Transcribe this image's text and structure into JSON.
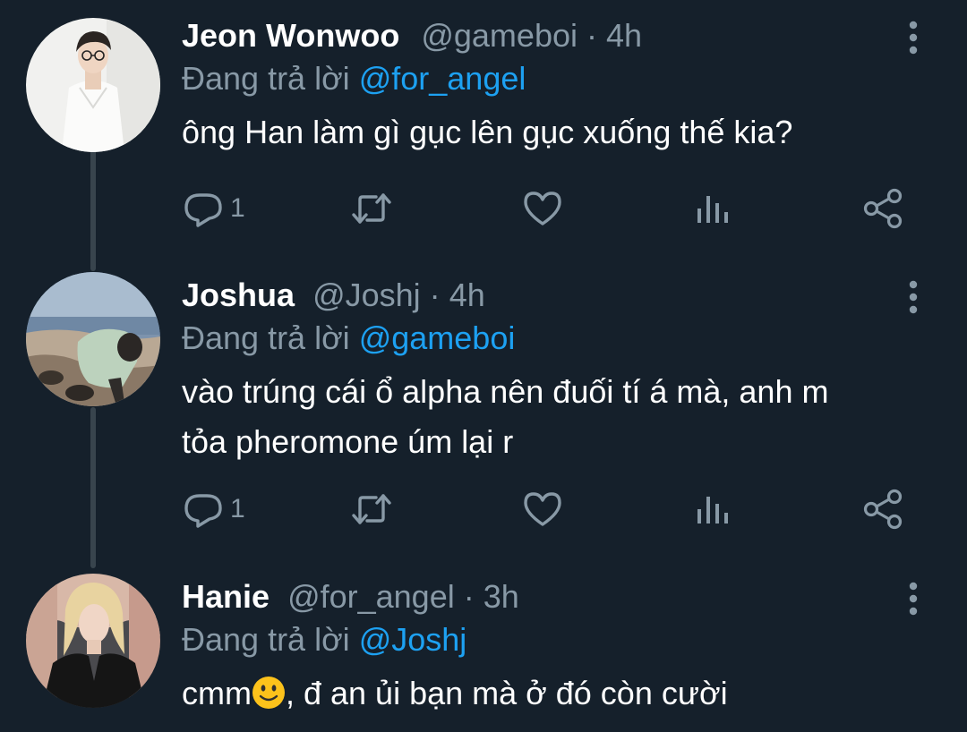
{
  "colors": {
    "background": "#15202b",
    "text_primary": "#ffffff",
    "text_secondary": "#8899a6",
    "accent": "#1da1f2",
    "thread_line": "#38444d"
  },
  "tweets": [
    {
      "name": "Jeon Wonwoo",
      "handle": "@gameboi",
      "separator": "·",
      "time": "4h",
      "reply_prefix": "Đang trả lời",
      "reply_to": "@for_angel",
      "text": "ông Han làm gì gục lên gục xuống thế kia?",
      "reply_count": "1"
    },
    {
      "name": "Joshua",
      "handle": "@Joshj",
      "separator": "·",
      "time": "4h",
      "reply_prefix": "Đang trả lời",
      "reply_to": "@gameboi",
      "text_line1": "vào trúng cái ổ alpha nên đuối tí á mà, anh m",
      "text_line2": "tỏa pheromone úm lại r",
      "reply_count": "1"
    },
    {
      "name": "Hanie",
      "handle": "@for_angel",
      "separator": "·",
      "time": "3h",
      "reply_prefix": "Đang trả lời",
      "reply_to": "@Joshj",
      "text_before_emoji": "cmm",
      "emoji": "slightly-smiling-face-emoji",
      "text_after_emoji": ", đ an ủi bạn mà ở đó còn cười"
    }
  ],
  "icons": {
    "reply": "reply-icon",
    "retweet": "retweet-icon",
    "like": "heart-icon",
    "analytics": "analytics-icon",
    "share": "share-icon",
    "more": "more-vertical-icon"
  }
}
